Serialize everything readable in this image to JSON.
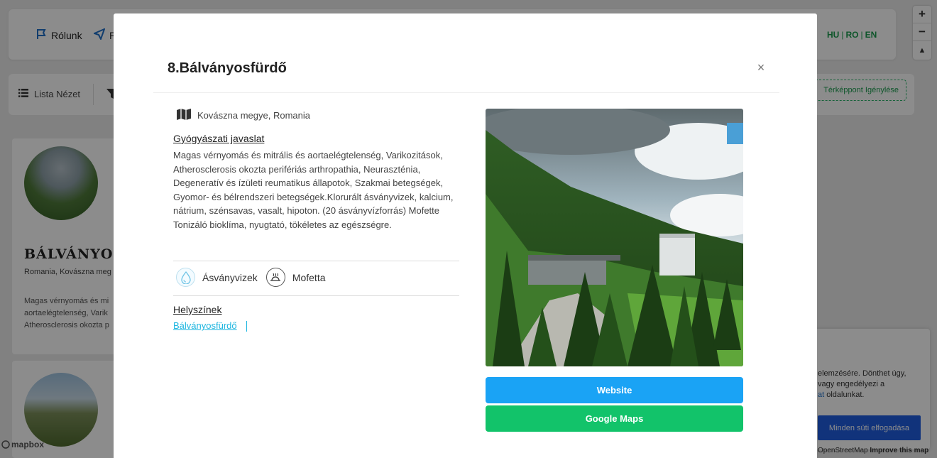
{
  "background": {
    "nav": {
      "items": [
        {
          "label": "Rólunk",
          "icon": "flag-icon"
        },
        {
          "label": "P",
          "icon": "send-icon"
        }
      ],
      "languages": [
        "HU",
        "RO",
        "EN"
      ]
    },
    "toolbar": {
      "list_view_label": "Lista Nézet",
      "request_label": "Térképpont Igénylése"
    },
    "card": {
      "title": "BÁLVÁNYOS",
      "subtitle": "Romania, Kovászna meg",
      "description_lines": [
        "Magas vérnyomás és mi",
        "aortaelégtelenség, Varik",
        "Atherosclerosis okozta p"
      ]
    },
    "map_controls": {
      "zoom_in": "+",
      "zoom_out": "−",
      "compass": "▲"
    },
    "cookie": {
      "line1": "elemzésére. Dönthet úgy,",
      "line2": "vagy engedélyezi a",
      "line3_link": "at",
      "line3_rest": " oldalunkat.",
      "accept_label": "Minden süti elfogadása"
    },
    "attribution": {
      "osm": "OpenStreetMap",
      "improve": "Improve this map"
    },
    "mapbox_logo": "mapbox"
  },
  "modal": {
    "title": "8.Bálványosfürdő",
    "close_label": "×",
    "location": "Kovászna megye, Romania",
    "recommendation_heading": "Gyógyászati javaslat",
    "description": "Magas vérnyomás és mitrális és aortaelégtelenség, Varikozitások, Atherosclerosis okozta perifériás arthropathia, Neuraszténia, Degeneratív és ízületi reumatikus állapotok, Szakmai betegségek, Gyomor- és bélrendszeri betegségek.Klorurált ásványvizek, kalcium, nátrium, szénsavas, vasalt, hipoton. (20 ásványvízforrás) Mofette Tonizáló bioklíma, nyugtató, tökéletes az egészségre.",
    "tags": [
      {
        "label": "Ásványvizek",
        "icon": "water-drop-icon"
      },
      {
        "label": "Mofetta",
        "icon": "mofetta-icon"
      }
    ],
    "places_heading": "Helyszínek",
    "place_link": "Bálványosfürdő",
    "website_button": "Website",
    "maps_button": "Google Maps"
  },
  "colors": {
    "website": "#1aa3f5",
    "maps": "#12c36a",
    "link": "#1eb6e0",
    "language": "#1a9c4e"
  }
}
